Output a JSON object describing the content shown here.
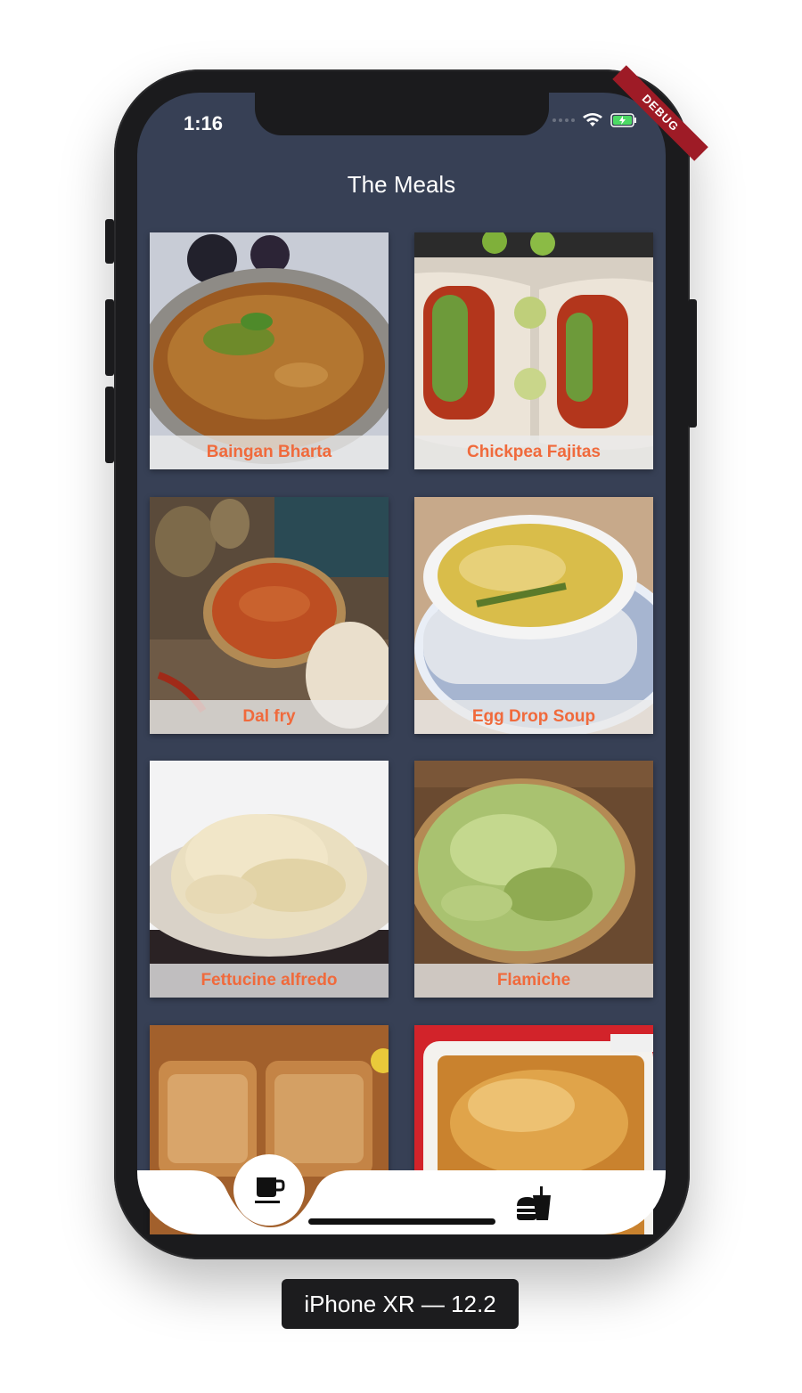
{
  "status_bar": {
    "time": "1:16",
    "debug_banner": "DEBUG"
  },
  "app_bar": {
    "title": "The Meals"
  },
  "meals": [
    {
      "name": "Baingan Bharta"
    },
    {
      "name": "Chickpea Fajitas"
    },
    {
      "name": "Dal fry"
    },
    {
      "name": "Egg Drop Soup"
    },
    {
      "name": "Fettucine alfredo"
    },
    {
      "name": "Flamiche"
    },
    {
      "name": ""
    },
    {
      "name": ""
    }
  ],
  "bottom_nav": {
    "items": [
      {
        "icon": "coffee-cup-icon",
        "active": true
      },
      {
        "icon": "burger-drink-icon",
        "active": false
      }
    ]
  },
  "device_label": "iPhone XR — 12.2",
  "colors": {
    "background": "#374055",
    "label_text": "#f06a3c",
    "nav_bar": "#ffffff",
    "debug_banner": "#9e1b26"
  }
}
